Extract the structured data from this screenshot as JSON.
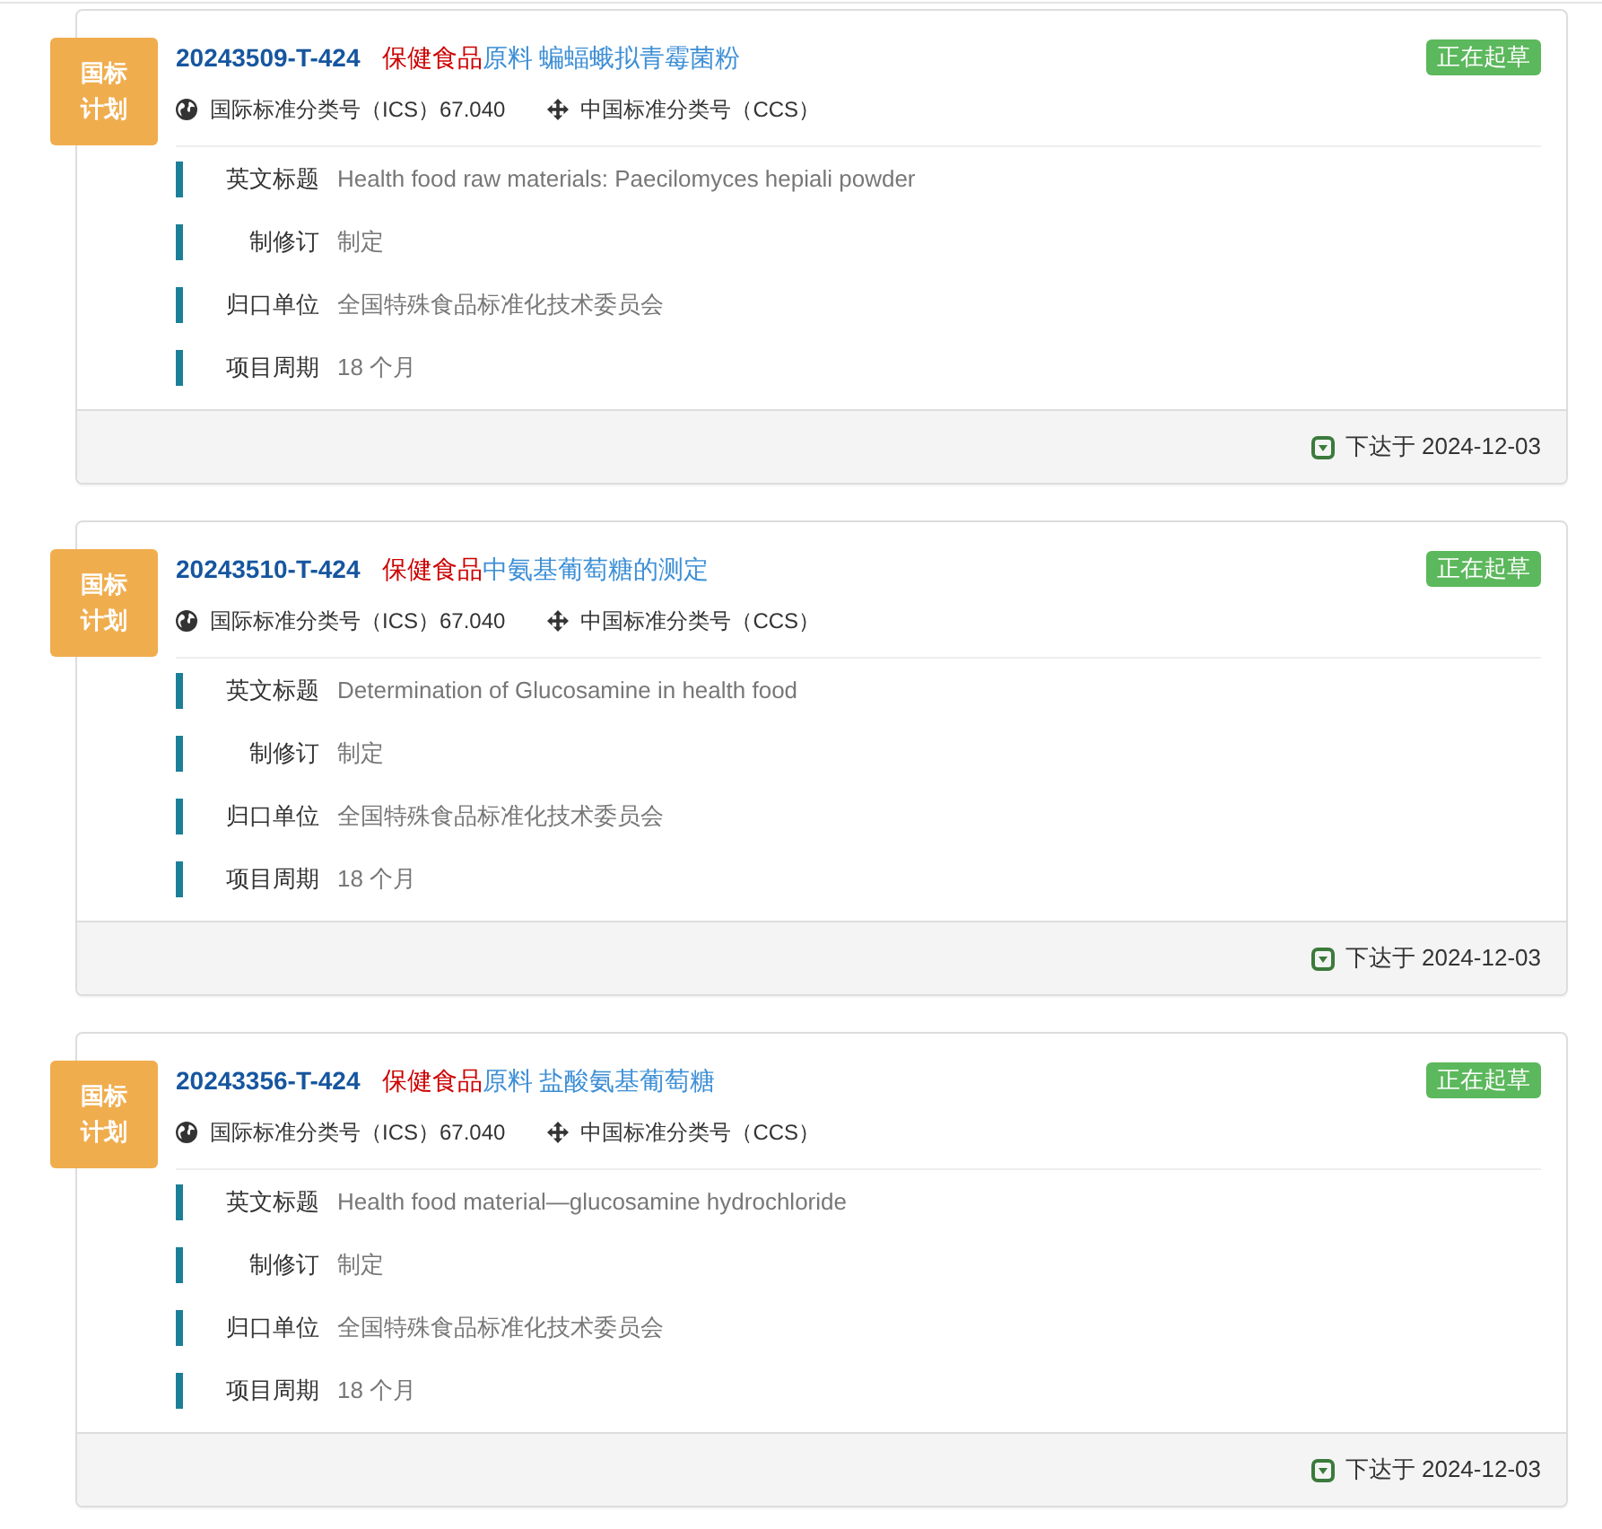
{
  "standards": [
    {
      "category_badge": "国标计划",
      "code": "20243509-T-424",
      "title": [
        {
          "text": "保健食品",
          "highlighted": true
        },
        {
          "text": "原料 蝙蝠蛾拟青霉菌粉",
          "highlighted": false
        }
      ],
      "status": "正在起草",
      "ics": "国际标准分类号（ICS）67.040",
      "ccs": "中国标准分类号（CCS）",
      "fields": [
        {
          "label": "英文标题",
          "value": "Health food raw materials: Paecilomyces hepiali powder"
        },
        {
          "label": "制修订",
          "value": "制定"
        },
        {
          "label": "归口单位",
          "value": "全国特殊食品标准化技术委员会"
        },
        {
          "label": "项目周期",
          "value": "18 个月"
        }
      ],
      "issued": "下达于 2024-12-03"
    },
    {
      "category_badge": "国标计划",
      "code": "20243510-T-424",
      "title": [
        {
          "text": "保健食品",
          "highlighted": true
        },
        {
          "text": "中氨基葡萄糖的测定",
          "highlighted": false
        }
      ],
      "status": "正在起草",
      "ics": "国际标准分类号（ICS）67.040",
      "ccs": "中国标准分类号（CCS）",
      "fields": [
        {
          "label": "英文标题",
          "value": "Determination of Glucosamine in health food"
        },
        {
          "label": "制修订",
          "value": "制定"
        },
        {
          "label": "归口单位",
          "value": "全国特殊食品标准化技术委员会"
        },
        {
          "label": "项目周期",
          "value": "18 个月"
        }
      ],
      "issued": "下达于 2024-12-03"
    },
    {
      "category_badge": "国标计划",
      "code": "20243356-T-424",
      "title": [
        {
          "text": "保健食品",
          "highlighted": true
        },
        {
          "text": "原料 盐酸氨基葡萄糖",
          "highlighted": false
        }
      ],
      "status": "正在起草",
      "ics": "国际标准分类号（ICS）67.040",
      "ccs": "中国标准分类号（CCS）",
      "fields": [
        {
          "label": "英文标题",
          "value": "Health food material—glucosamine hydrochloride"
        },
        {
          "label": "制修订",
          "value": "制定"
        },
        {
          "label": "归口单位",
          "value": "全国特殊食品标准化技术委员会"
        },
        {
          "label": "项目周期",
          "value": "18 个月"
        }
      ],
      "issued": "下达于 2024-12-03"
    }
  ]
}
